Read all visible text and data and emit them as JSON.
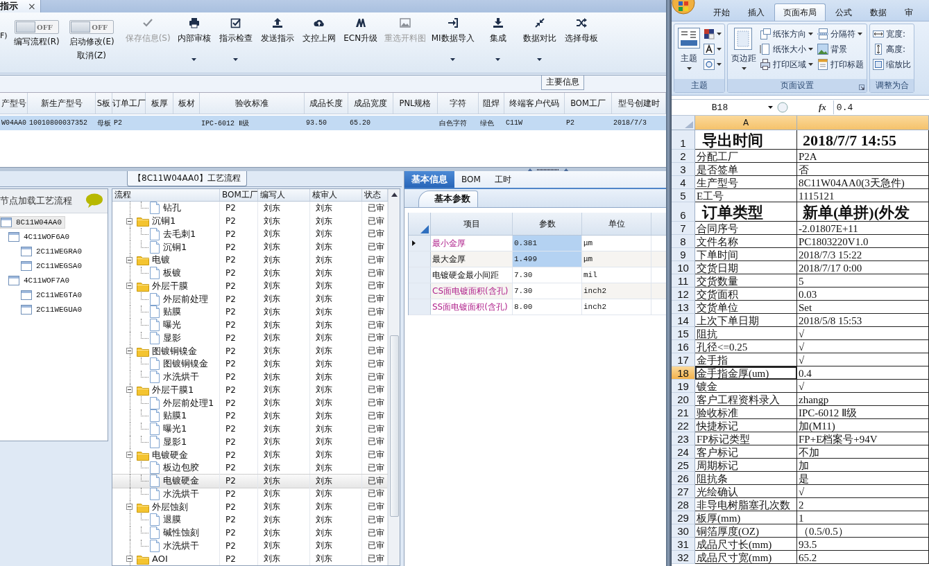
{
  "document_tab": {
    "title": "指示",
    "close": "×"
  },
  "toolbar": {
    "items": [
      {
        "kind": "cut",
        "label": "F)"
      },
      {
        "kind": "toggle",
        "state_label": "OFF",
        "on": false,
        "label": "编写流程(R)"
      },
      {
        "kind": "toggle",
        "state_label": "OFF",
        "on": false,
        "label": "启动修改(E)",
        "sub_label": "取消(Z)"
      },
      {
        "kind": "button",
        "label": "保存信息(S)",
        "disabled": true,
        "dropdown": false
      },
      {
        "kind": "button",
        "label": "内部审核",
        "disabled": false,
        "dropdown": true
      },
      {
        "kind": "button",
        "label": "指示检查",
        "disabled": false,
        "dropdown": true
      },
      {
        "kind": "button",
        "label": "发送指示",
        "disabled": false,
        "dropdown": false
      },
      {
        "kind": "button",
        "label": "文控上网",
        "disabled": false,
        "dropdown": false
      },
      {
        "kind": "button",
        "label": "ECN升级",
        "disabled": false,
        "dropdown": false
      },
      {
        "kind": "button",
        "label": "重选开料图",
        "disabled": true,
        "dropdown": false
      },
      {
        "kind": "button",
        "label": "MI数据导入",
        "disabled": false,
        "dropdown": true
      },
      {
        "kind": "button",
        "label": "集成",
        "disabled": false,
        "dropdown": true
      },
      {
        "kind": "button",
        "label": "数据对比",
        "disabled": false,
        "dropdown": true
      },
      {
        "kind": "button",
        "label": "选择母板",
        "disabled": false,
        "dropdown": false
      }
    ]
  },
  "section_label": "主要信息",
  "main_table": {
    "columns": [
      "产型号",
      "新生产型号",
      "S板",
      "订单工厂",
      "板厚",
      "板材",
      "验收标准",
      "成品长度",
      "成品宽度",
      "PNL规格",
      "字符",
      "阻焊",
      "终端客户代码",
      "BOM工厂",
      "型号创建时"
    ],
    "rows": [
      {
        "selected": true,
        "cells": [
          "W04AA0",
          "10010800037352",
          "母板",
          "P2",
          null,
          null,
          "IPC-6012 Ⅱ级",
          "93.50",
          "65.20",
          null,
          "白色字符",
          "绿色",
          "C11W",
          "P2",
          "2018/7/3"
        ]
      }
    ]
  },
  "process_title": "【8C11W04AA0】工艺流程",
  "product_tree": {
    "header": "节点加载工艺流程",
    "nodes": [
      {
        "label": "8C11W04AA0",
        "selected": true,
        "children": [
          {
            "label": "4C11WOF6A0",
            "selected": false,
            "children": [
              {
                "label": "2C11WEGRA0",
                "selected": false
              },
              {
                "label": "2C11WEGSA0",
                "selected": false
              }
            ]
          },
          {
            "label": "4C11WOF7A0",
            "selected": false,
            "children": [
              {
                "label": "2C11WEGTA0",
                "selected": false
              },
              {
                "label": "2C11WEGUA0",
                "selected": false
              }
            ]
          }
        ]
      }
    ]
  },
  "process_table": {
    "columns": [
      "流程",
      "BOM工厂",
      "编写人",
      "核审人",
      "状态"
    ],
    "rows": [
      {
        "kind": "step",
        "label": "钻孔",
        "factory": "P2",
        "writer": "刘东",
        "reviewer": "刘东",
        "status": "已审",
        "selected": false
      },
      {
        "kind": "folder",
        "label": "沉铜1",
        "factory": "P2",
        "writer": "刘东",
        "reviewer": "刘东",
        "status": "已审",
        "selected": false,
        "expanded": true,
        "children": [
          {
            "kind": "step",
            "label": "去毛刺1",
            "factory": "P2",
            "writer": "刘东",
            "reviewer": "刘东",
            "status": "已审",
            "selected": false
          },
          {
            "kind": "step",
            "label": "沉铜1",
            "factory": "P2",
            "writer": "刘东",
            "reviewer": "刘东",
            "status": "已审",
            "selected": false
          }
        ]
      },
      {
        "kind": "folder",
        "label": "电镀",
        "factory": "P2",
        "writer": "刘东",
        "reviewer": "刘东",
        "status": "已审",
        "selected": false,
        "expanded": true,
        "children": [
          {
            "kind": "step",
            "label": "板镀",
            "factory": "P2",
            "writer": "刘东",
            "reviewer": "刘东",
            "status": "已审",
            "selected": false
          }
        ]
      },
      {
        "kind": "folder",
        "label": "外层干膜",
        "factory": "P2",
        "writer": "刘东",
        "reviewer": "刘东",
        "status": "已审",
        "selected": false,
        "expanded": true,
        "children": [
          {
            "kind": "step",
            "label": "外层前处理",
            "factory": "P2",
            "writer": "刘东",
            "reviewer": "刘东",
            "status": "已审",
            "selected": false
          },
          {
            "kind": "step",
            "label": "贴膜",
            "factory": "P2",
            "writer": "刘东",
            "reviewer": "刘东",
            "status": "已审",
            "selected": false
          },
          {
            "kind": "step",
            "label": "曝光",
            "factory": "P2",
            "writer": "刘东",
            "reviewer": "刘东",
            "status": "已审",
            "selected": false
          },
          {
            "kind": "step",
            "label": "显影",
            "factory": "P2",
            "writer": "刘东",
            "reviewer": "刘东",
            "status": "已审",
            "selected": false
          }
        ]
      },
      {
        "kind": "folder",
        "label": "图镀铜镍金",
        "factory": "P2",
        "writer": "刘东",
        "reviewer": "刘东",
        "status": "已审",
        "selected": false,
        "expanded": true,
        "children": [
          {
            "kind": "step",
            "label": "图镀铜镍金",
            "factory": "P2",
            "writer": "刘东",
            "reviewer": "刘东",
            "status": "已审",
            "selected": false
          },
          {
            "kind": "step",
            "label": "水洗烘干",
            "factory": "P2",
            "writer": "刘东",
            "reviewer": "刘东",
            "status": "已审",
            "selected": false
          }
        ]
      },
      {
        "kind": "folder",
        "label": "外层干膜1",
        "factory": "P2",
        "writer": "刘东",
        "reviewer": "刘东",
        "status": "已审",
        "selected": false,
        "expanded": true,
        "children": [
          {
            "kind": "step",
            "label": "外层前处理1",
            "factory": "P2",
            "writer": "刘东",
            "reviewer": "刘东",
            "status": "已审",
            "selected": false
          },
          {
            "kind": "step",
            "label": "贴膜1",
            "factory": "P2",
            "writer": "刘东",
            "reviewer": "刘东",
            "status": "已审",
            "selected": false
          },
          {
            "kind": "step",
            "label": "曝光1",
            "factory": "P2",
            "writer": "刘东",
            "reviewer": "刘东",
            "status": "已审",
            "selected": false
          },
          {
            "kind": "step",
            "label": "显影1",
            "factory": "P2",
            "writer": "刘东",
            "reviewer": "刘东",
            "status": "已审",
            "selected": false
          }
        ]
      },
      {
        "kind": "folder",
        "label": "电镀硬金",
        "factory": "P2",
        "writer": "刘东",
        "reviewer": "刘东",
        "status": "已审",
        "selected": false,
        "expanded": true,
        "children": [
          {
            "kind": "step",
            "label": "板边包胶",
            "factory": "P2",
            "writer": "刘东",
            "reviewer": "刘东",
            "status": "已审",
            "selected": false
          },
          {
            "kind": "step",
            "label": "电镀硬金",
            "factory": "P2",
            "writer": "刘东",
            "reviewer": "刘东",
            "status": "已审",
            "selected": true
          },
          {
            "kind": "step",
            "label": "水洗烘干",
            "factory": "P2",
            "writer": "刘东",
            "reviewer": "刘东",
            "status": "已审",
            "selected": false
          }
        ]
      },
      {
        "kind": "folder",
        "label": "外层蚀刻",
        "factory": "P2",
        "writer": "刘东",
        "reviewer": "刘东",
        "status": "已审",
        "selected": false,
        "expanded": true,
        "children": [
          {
            "kind": "step",
            "label": "退膜",
            "factory": "P2",
            "writer": "刘东",
            "reviewer": "刘东",
            "status": "已审",
            "selected": false
          },
          {
            "kind": "step",
            "label": "碱性蚀刻",
            "factory": "P2",
            "writer": "刘东",
            "reviewer": "刘东",
            "status": "已审",
            "selected": false
          },
          {
            "kind": "step",
            "label": "水洗烘干",
            "factory": "P2",
            "writer": "刘东",
            "reviewer": "刘东",
            "status": "已审",
            "selected": false
          }
        ]
      },
      {
        "kind": "folder",
        "label": "AOI",
        "factory": "P2",
        "writer": "刘东",
        "reviewer": "刘东",
        "status": "已审",
        "selected": false,
        "expanded": true
      }
    ]
  },
  "detail_panel": {
    "tabs": [
      {
        "label": "基本信息",
        "selected": true
      },
      {
        "label": "BOM",
        "selected": false
      },
      {
        "label": "工时",
        "selected": false
      }
    ],
    "subtabs": [
      {
        "label": "基本参数",
        "selected": true
      }
    ],
    "columns": [
      "项目",
      "参数",
      "单位"
    ],
    "rows": [
      {
        "item": "最小金厚",
        "value": "0.381",
        "unit": "μm",
        "highlighted": true,
        "current": true,
        "selected": true
      },
      {
        "item": "最大金厚",
        "value": "1.499",
        "unit": "μm",
        "highlighted": false,
        "current": false,
        "selected": true
      },
      {
        "item": "电镀硬金最小间距",
        "value": "7.30",
        "unit": "mil",
        "highlighted": false,
        "current": false,
        "selected": false
      },
      {
        "item": "CS面电镀面积(含孔)",
        "value": "7.30",
        "unit": "inch2",
        "highlighted": true,
        "current": false,
        "selected": false
      },
      {
        "item": "SS面电镀面积(含孔)",
        "value": "8.00",
        "unit": "inch2",
        "highlighted": true,
        "current": false,
        "selected": false
      }
    ]
  },
  "excel": {
    "tabs": [
      {
        "label": "开始",
        "selected": false
      },
      {
        "label": "插入",
        "selected": false
      },
      {
        "label": "页面布局",
        "selected": true
      },
      {
        "label": "公式",
        "selected": false
      },
      {
        "label": "数据",
        "selected": false
      },
      {
        "label": "审",
        "selected": false
      }
    ],
    "groups": [
      {
        "title": "主题",
        "launcher": false,
        "large": [
          {
            "label": "主题",
            "dropdown": true
          }
        ],
        "small": [
          {
            "dropdown": true
          },
          {
            "dropdown": true
          },
          {
            "dropdown": true
          }
        ]
      },
      {
        "title": "页面设置",
        "launcher": true,
        "large": [
          {
            "label": "页边距",
            "dropdown": true
          }
        ],
        "small": [
          {
            "label": "纸张方向",
            "dropdown": true
          },
          {
            "label": "纸张大小",
            "dropdown": true
          },
          {
            "label": "打印区域",
            "dropdown": true
          },
          {
            "label": "分隔符",
            "dropdown": true
          },
          {
            "label": "背景",
            "dropdown": false
          },
          {
            "label": "打印标题",
            "dropdown": false
          }
        ]
      },
      {
        "title": "调整为合",
        "launcher": false,
        "small": [
          {
            "label": "宽度:",
            "dropdown": false
          },
          {
            "label": "高度:",
            "dropdown": false
          },
          {
            "label": "缩放比",
            "dropdown": false
          }
        ]
      }
    ],
    "name_box": "B18",
    "formula_label": "fx",
    "formula": "0.4",
    "column_header": "A",
    "rows": [
      {
        "number": "1",
        "kind": "heading",
        "a": "导出时间",
        "b": "2018/7/7 14:55",
        "selected": false
      },
      {
        "number": "2",
        "kind": "normal",
        "a": "分配工厂",
        "b": "P2A",
        "selected": false
      },
      {
        "number": "3",
        "kind": "normal",
        "a": "是否签单",
        "b": "否",
        "selected": false
      },
      {
        "number": "4",
        "kind": "normal",
        "a": "生产型号",
        "b": "8C11W04AA0(3天急件)",
        "selected": false
      },
      {
        "number": "5",
        "kind": "normal",
        "a": "E工号",
        "b": "1115121",
        "selected": false
      },
      {
        "number": "6",
        "kind": "heading",
        "a": "订单类型",
        "b": "新单(单拼)(外发",
        "selected": false
      },
      {
        "number": "7",
        "kind": "normal",
        "a": "合同序号",
        "b": "-2.01807E+11",
        "selected": false
      },
      {
        "number": "8",
        "kind": "normal",
        "a": "文件名称",
        "b": "PC1803220V1.0",
        "selected": false
      },
      {
        "number": "9",
        "kind": "normal",
        "a": "下单时间",
        "b": "2018/7/3 15:22",
        "selected": false
      },
      {
        "number": "10",
        "kind": "normal",
        "a": "交货日期",
        "b": "2018/7/17 0:00",
        "selected": false
      },
      {
        "number": "11",
        "kind": "normal",
        "a": "交货数量",
        "b": "5",
        "selected": false
      },
      {
        "number": "12",
        "kind": "normal",
        "a": "交货面积",
        "b": "0.03",
        "selected": false
      },
      {
        "number": "13",
        "kind": "normal",
        "a": "交货单位",
        "b": "Set",
        "selected": false
      },
      {
        "number": "14",
        "kind": "normal",
        "a": "上次下单日期",
        "b": "2018/5/8 15:53",
        "selected": false
      },
      {
        "number": "15",
        "kind": "normal",
        "a": "阻抗",
        "b": "√",
        "selected": false
      },
      {
        "number": "16",
        "kind": "normal",
        "a": "孔径<=0.25",
        "b": "√",
        "selected": false
      },
      {
        "number": "17",
        "kind": "normal",
        "a": "金手指",
        "b": "√",
        "selected": false
      },
      {
        "number": "18",
        "kind": "normal",
        "a": "金手指金厚(um)",
        "b": "0.4",
        "selected": true
      },
      {
        "number": "19",
        "kind": "normal",
        "a": "镀金",
        "b": "√",
        "selected": false
      },
      {
        "number": "20",
        "kind": "normal",
        "a": "客户工程资料录入",
        "b": "zhangp",
        "selected": false
      },
      {
        "number": "21",
        "kind": "normal",
        "a": "验收标准",
        "b": "IPC-6012 Ⅱ级",
        "selected": false
      },
      {
        "number": "22",
        "kind": "normal",
        "a": "快捷标记",
        "b": "加(M11)",
        "selected": false
      },
      {
        "number": "23",
        "kind": "normal",
        "a": "FP标记类型",
        "b": "FP+E档案号+94V",
        "selected": false
      },
      {
        "number": "24",
        "kind": "normal",
        "a": "客户标记",
        "b": "不加",
        "selected": false
      },
      {
        "number": "25",
        "kind": "normal",
        "a": "周期标记",
        "b": "加",
        "selected": false
      },
      {
        "number": "26",
        "kind": "normal",
        "a": "阻抗条",
        "b": "是",
        "selected": false
      },
      {
        "number": "27",
        "kind": "normal",
        "a": "光绘确认",
        "b": "√",
        "selected": false
      },
      {
        "number": "28",
        "kind": "normal",
        "a": "非导电树脂塞孔次数",
        "b": "2",
        "selected": false
      },
      {
        "number": "29",
        "kind": "normal",
        "a": "板厚(mm)",
        "b": "1",
        "selected": false
      },
      {
        "number": "30",
        "kind": "normal",
        "a": "铜箔厚度(OZ)",
        "b": "（0.5/0.5）",
        "selected": false
      },
      {
        "number": "31",
        "kind": "normal",
        "a": "成品尺寸长(mm)",
        "b": "93.5",
        "selected": false
      },
      {
        "number": "32",
        "kind": "normal",
        "a": "成品尺寸宽(mm)",
        "b": "65.2",
        "selected": false
      }
    ]
  }
}
